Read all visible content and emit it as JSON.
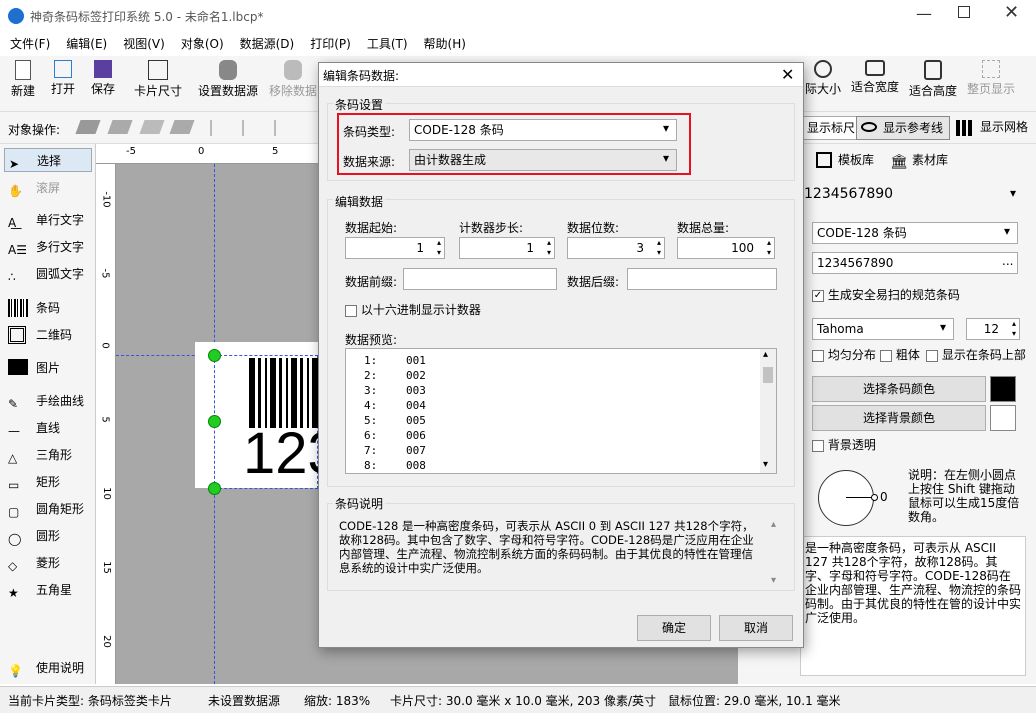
{
  "window": {
    "title": "神奇条码标签打印系统 5.0 - 未命名1.lbcp*"
  },
  "menu": [
    "文件(F)",
    "编辑(E)",
    "视图(V)",
    "对象(O)",
    "数据源(D)",
    "打印(P)",
    "工具(T)",
    "帮助(H)"
  ],
  "toolbar": {
    "new": "新建",
    "open": "打开",
    "save": "保存",
    "card_size": "卡片尺寸",
    "set_ds": "设置数据源",
    "remove_ds": "移除数据",
    "actual_size": "际大小",
    "fit_width": "适合宽度",
    "fit_height": "适合高度",
    "whole_page": "整页显示"
  },
  "objbar": {
    "label": "对象操作:",
    "show_ruler": "显示标尺",
    "show_ref": "显示参考线",
    "show_grid": "显示网格"
  },
  "tools": [
    "选择",
    "滚屏",
    "单行文字",
    "多行文字",
    "圆弧文字",
    "条码",
    "二维码",
    "图片",
    "手绘曲线",
    "直线",
    "三角形",
    "矩形",
    "圆角矩形",
    "圆形",
    "菱形",
    "五角星",
    "使用说明"
  ],
  "canvas": {
    "barcode_text": "123",
    "hruler": [
      "-5",
      "0",
      "5"
    ],
    "vruler": [
      "-10",
      "-5",
      "0",
      "5",
      "10",
      "15",
      "20"
    ]
  },
  "right": {
    "tab_template": "模板库",
    "tab_material": "素材库",
    "value": "1234567890",
    "type": "CODE-128 条码",
    "data": "1234567890",
    "data_btn": "...",
    "safe_check": "生成安全易扫的规范条码",
    "font": "Tahoma",
    "font_size": "12",
    "even": "均匀分布",
    "bold": "粗体",
    "above": "显示在条码上部",
    "bar_color_btn": "选择条码颜色",
    "bg_color_btn": "选择背景颜色",
    "bg_transparent": "背景透明",
    "angle": "0",
    "note": "说明：在左侧小圆点上按住 Shift 键拖动鼠标可以生成15度倍数角。",
    "desc": "是一种高密度条码，可表示从 ASCII 127 共128个字符，故称128码。其字、字母和符号字符。CODE-128码在企业内部管理、生产流程、物流控的条码码制。由于其优良的特性在管的设计中实广泛使用。"
  },
  "dialog": {
    "title": "编辑条码数据:",
    "group_barcode": "条码设置",
    "type_label": "条码类型:",
    "type_value": "CODE-128 条码",
    "source_label": "数据来源:",
    "source_value": "由计数器生成",
    "group_edit": "编辑数据",
    "start_label": "数据起始:",
    "start_value": "1",
    "step_label": "计数器步长:",
    "step_value": "1",
    "digits_label": "数据位数:",
    "digits_value": "3",
    "total_label": "数据总量:",
    "total_value": "100",
    "prefix_label": "数据前缀:",
    "prefix_value": "",
    "suffix_label": "数据后缀:",
    "suffix_value": "",
    "hex_label": "以十六进制显示计数器",
    "preview_label": "数据预览:",
    "preview": [
      {
        "n": "1:",
        "v": "001"
      },
      {
        "n": "2:",
        "v": "002"
      },
      {
        "n": "3:",
        "v": "003"
      },
      {
        "n": "4:",
        "v": "004"
      },
      {
        "n": "5:",
        "v": "005"
      },
      {
        "n": "6:",
        "v": "006"
      },
      {
        "n": "7:",
        "v": "007"
      },
      {
        "n": "8:",
        "v": "008"
      }
    ],
    "group_desc": "条码说明",
    "desc": "CODE-128 是一种高密度条码，可表示从 ASCII 0 到 ASCII 127 共128个字符，故称128码。其中包含了数字、字母和符号字符。CODE-128码是广泛应用在企业内部管理、生产流程、物流控制系统方面的条码码制。由于其优良的特性在管理信息系统的设计中实广泛使用。",
    "ok": "确定",
    "cancel": "取消"
  },
  "status": {
    "card_type": "当前卡片类型: 条码标签类卡片",
    "ds": "未设置数据源",
    "zoom": "缩放: 183%",
    "card_size": "卡片尺寸: 30.0 毫米 x 10.0 毫米, 203 像素/英寸",
    "mouse": "鼠标位置: 29.0 毫米, 10.1 毫米"
  },
  "colors": {
    "highlight": "#e81123",
    "accent": "#0078d7",
    "handle": "#22cc22"
  }
}
